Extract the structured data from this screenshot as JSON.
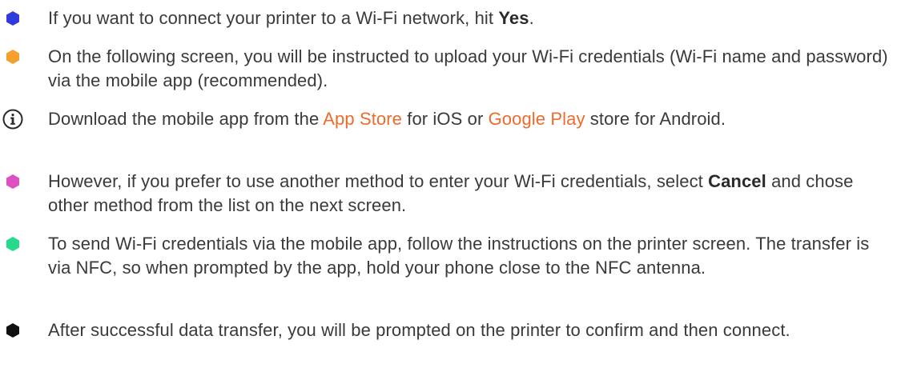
{
  "steps": [
    {
      "icon": "blue-hexagon-bullet-icon",
      "color": "#2f3bdc",
      "before": "If you want to connect your printer to a Wi-Fi network, hit ",
      "bold": "Yes",
      "after": "."
    },
    {
      "icon": "orange-hexagon-bullet-icon",
      "color": "#f5a02e",
      "text": "On the following screen, you will be instructed to upload your Wi-Fi credentials (Wi-Fi name and password) via the mobile app (recommended)."
    },
    {
      "icon": "info-icon",
      "before": "Download the mobile app from the ",
      "link1": "App Store",
      "middle": " for iOS or ",
      "link2": "Google Play",
      "after": " store for Android."
    },
    {
      "icon": "pink-hexagon-bullet-icon",
      "color": "#e04fc0",
      "before": "However, if you prefer to use another method to enter your Wi-Fi credentials, select ",
      "bold": "Cancel",
      "after": " and chose other method from the list on the next screen."
    },
    {
      "icon": "green-hexagon-bullet-icon",
      "color": "#27d98a",
      "text": "To send Wi-Fi credentials via the mobile app, follow the instructions on the printer screen. The transfer is via NFC, so when prompted by the app, hold your phone close to the NFC antenna."
    },
    {
      "icon": "black-hexagon-bullet-icon",
      "color": "#111111",
      "text": "After successful data transfer, you will be prompted on the printer to confirm and then connect."
    }
  ],
  "colors": {
    "link": "#ec6b2d",
    "text": "#3a3a3a"
  }
}
